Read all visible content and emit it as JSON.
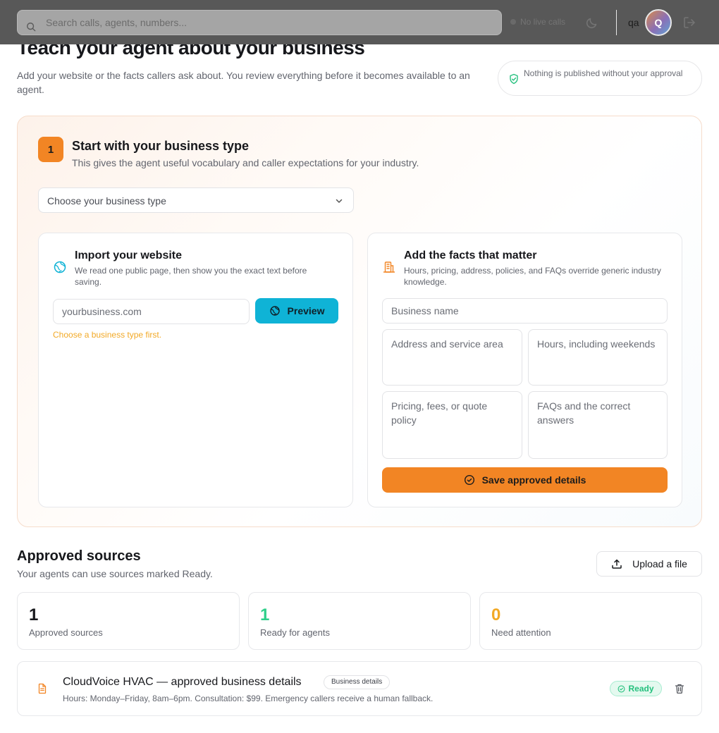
{
  "topbar": {
    "search_placeholder": "Search calls, agents, numbers...",
    "live_status": "No live calls",
    "user_label": "qa",
    "avatar_initial": "Q"
  },
  "header": {
    "title": "Teach your agent about your business",
    "subtitle": "Add your website or the facts callers ask about. You review everything before it becomes available to an agent.",
    "approval_note": "Nothing is published without your approval"
  },
  "setup": {
    "step_number": "1",
    "step_title": "Start with your business type",
    "step_subtitle": "This gives the agent useful vocabulary and caller expectations for your industry.",
    "business_type_placeholder": "Choose your business type",
    "website": {
      "title": "Import your website",
      "subtitle": "We read one public page, then show you the exact text before saving.",
      "url_placeholder": "yourbusiness.com",
      "preview_label": "Preview",
      "hint": "Choose a business type first."
    },
    "facts": {
      "title": "Add the facts that matter",
      "subtitle": "Hours, pricing, address, policies, and FAQs override generic industry knowledge.",
      "business_name_placeholder": "Business name",
      "address_placeholder": "Address and service area",
      "hours_placeholder": "Hours, including weekends",
      "pricing_placeholder": "Pricing, fees, or quote policy",
      "faqs_placeholder": "FAQs and the correct answers",
      "save_label": "Save approved details"
    }
  },
  "sources": {
    "title": "Approved sources",
    "subtitle": "Your agents can use sources marked Ready.",
    "upload_label": "Upload a file",
    "stats": [
      {
        "value": "1",
        "label": "Approved sources"
      },
      {
        "value": "1",
        "label": "Ready for agents"
      },
      {
        "value": "0",
        "label": "Need attention"
      }
    ],
    "items": [
      {
        "title": "CloudVoice HVAC — approved business details",
        "tag": "Business details",
        "description": "Hours: Monday–Friday, 8am–6pm. Consultation: $99. Emergency callers receive a human fallback.",
        "status": "Ready"
      }
    ]
  },
  "colors": {
    "accent_orange": "#f28524",
    "accent_cyan": "#0fb3d6",
    "ready_green": "#2fcf8a",
    "warning_amber": "#f2a926",
    "topbar": "#585858"
  },
  "icons": [
    "search-icon",
    "moon-icon",
    "logout-icon",
    "shield-check-icon",
    "chevron-down-icon",
    "globe-icon",
    "building-icon",
    "check-circle-icon",
    "upload-icon",
    "document-icon",
    "trash-icon"
  ]
}
